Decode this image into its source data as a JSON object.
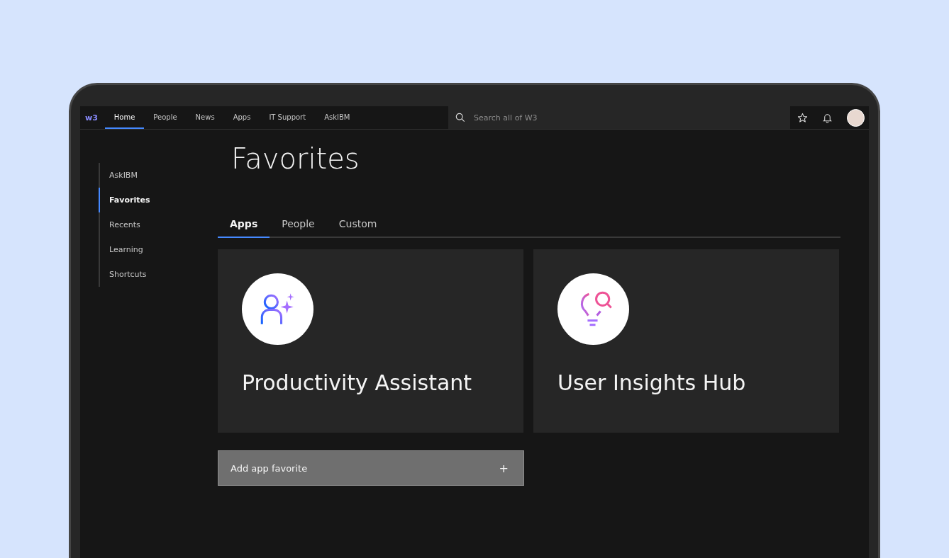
{
  "nav": {
    "logo": "w3",
    "items": [
      {
        "label": "Home",
        "selected": true
      },
      {
        "label": "People",
        "selected": false
      },
      {
        "label": "News",
        "selected": false
      },
      {
        "label": "Apps",
        "selected": false
      },
      {
        "label": "IT Support",
        "selected": false
      },
      {
        "label": "AskIBM",
        "selected": false
      }
    ],
    "search": {
      "placeholder": "Search all of W3"
    }
  },
  "sidebar": {
    "items": [
      {
        "label": "AskIBM",
        "selected": false
      },
      {
        "label": "Favorites",
        "selected": true
      },
      {
        "label": "Recents",
        "selected": false
      },
      {
        "label": "Learning",
        "selected": false
      },
      {
        "label": "Shortcuts",
        "selected": false
      }
    ]
  },
  "page_title": "Favorites",
  "tabs": [
    {
      "label": "Apps",
      "selected": true
    },
    {
      "label": "People",
      "selected": false
    },
    {
      "label": "Custom",
      "selected": false
    }
  ],
  "cards": [
    {
      "kind": "assistant",
      "title": "Productivity Assistant"
    },
    {
      "kind": "insights",
      "title": "User Insights Hub"
    }
  ],
  "add_button": {
    "label": "Add app favorite",
    "icon": "+"
  }
}
